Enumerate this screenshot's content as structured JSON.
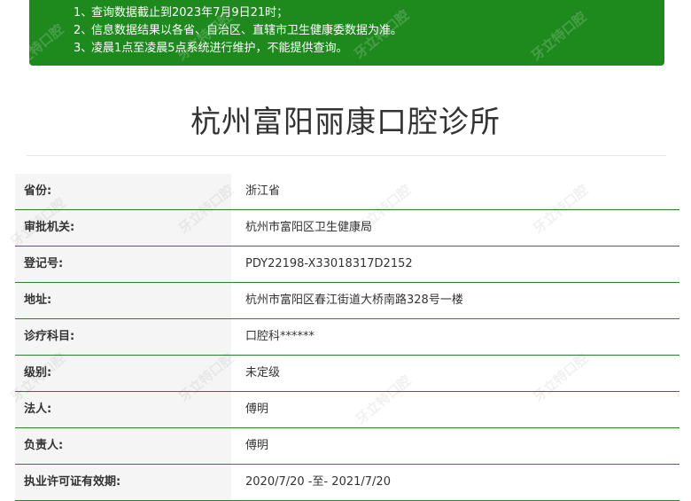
{
  "notice": {
    "lines": [
      {
        "num": "1、",
        "text": "查询数据截止到2023年7月9日21时；"
      },
      {
        "num": "2、",
        "text": "信息数据结果以各省、自治区、直辖市卫生健康委数据为准。"
      },
      {
        "num": "3、",
        "text": "凌晨1点至凌晨5点系统进行维护，不能提供查询。"
      }
    ]
  },
  "clinic": {
    "title": "杭州富阳丽康口腔诊所"
  },
  "info_rows": [
    {
      "label": "省份:",
      "value": "浙江省"
    },
    {
      "label": "审批机关:",
      "value": "杭州市富阳区卫生健康局"
    },
    {
      "label": "登记号:",
      "value": "PDY22198-X33018317D2152"
    },
    {
      "label": "地址:",
      "value": "杭州市富阳区春江街道大桥南路328号一楼"
    },
    {
      "label": "诊疗科目:",
      "value": "口腔科******"
    },
    {
      "label": "级别:",
      "value": "未定级"
    },
    {
      "label": "法人:",
      "value": "傅明"
    },
    {
      "label": "负责人:",
      "value": "傅明"
    },
    {
      "label": "执业许可证有效期:",
      "value": "2020/7/20 -至- 2021/7/20"
    }
  ],
  "watermark": {
    "text": "牙立特口腔"
  }
}
